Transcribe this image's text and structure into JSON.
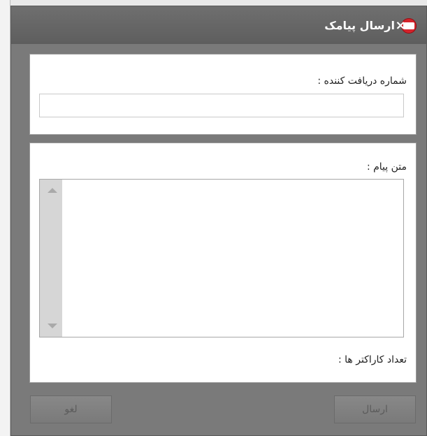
{
  "window": {
    "title": "ارسال پیامک",
    "close_label": "×"
  },
  "form": {
    "recipient_label": "شماره دریافت کننده :",
    "recipient_value": "",
    "message_label": "متن پیام :",
    "message_value": "",
    "char_count_label": "تعداد کاراکتر ها :"
  },
  "buttons": {
    "send_label": "ارسال",
    "cancel_label": "لغو"
  },
  "icons": {
    "app_logo": "sms-logo-icon",
    "close": "close-icon",
    "scroll_up": "arrow-up-icon",
    "scroll_down": "arrow-down-icon"
  },
  "colors": {
    "titlebar": "#666666",
    "logo": "#d5232b",
    "panel": "#ffffff"
  }
}
